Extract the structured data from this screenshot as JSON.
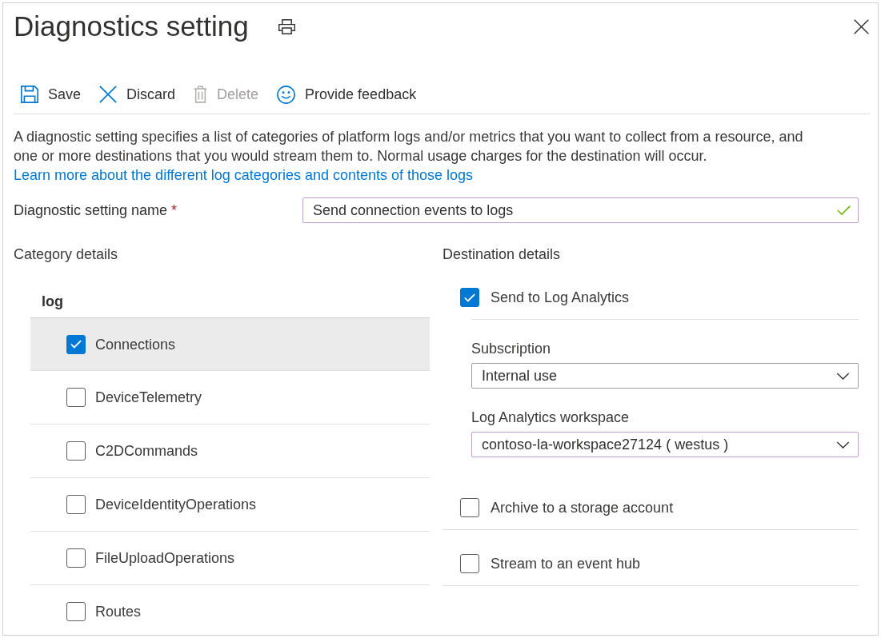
{
  "panel": {
    "title": "Diagnostics setting"
  },
  "toolbar": [
    {
      "kind": "save",
      "label": "Save",
      "disabled": false
    },
    {
      "kind": "discard",
      "label": "Discard",
      "disabled": false
    },
    {
      "kind": "delete",
      "label": "Delete",
      "disabled": true
    },
    {
      "kind": "feedback",
      "label": "Provide feedback",
      "disabled": false
    }
  ],
  "description": {
    "text": "A diagnostic setting specifies a list of categories of platform logs and/or metrics that you want to collect from a resource, and one or more destinations that you would stream them to. Normal usage charges for the destination will occur.",
    "link": "Learn more about the different log categories and contents of those logs"
  },
  "setting_name": {
    "label": "Diagnostic setting name",
    "required_mark": "*",
    "value": "Send connection events to logs",
    "valid": true
  },
  "category_details": {
    "heading": "Category details",
    "column_header": "log",
    "categories": [
      {
        "label": "Connections",
        "checked": true,
        "selected": true
      },
      {
        "label": "DeviceTelemetry",
        "checked": false,
        "selected": false
      },
      {
        "label": "C2DCommands",
        "checked": false,
        "selected": false
      },
      {
        "label": "DeviceIdentityOperations",
        "checked": false,
        "selected": false
      },
      {
        "label": "FileUploadOperations",
        "checked": false,
        "selected": false
      },
      {
        "label": "Routes",
        "checked": false,
        "selected": false
      }
    ]
  },
  "destination_details": {
    "heading": "Destination details",
    "destinations": [
      {
        "label": "Send to Log Analytics",
        "checked": true,
        "fields": [
          {
            "label": "Subscription",
            "value": "Internal use",
            "focused": false
          },
          {
            "label": "Log Analytics workspace",
            "value": "contoso-la-workspace27124 ( westus )",
            "focused": true
          }
        ]
      },
      {
        "label": "Archive to a storage account",
        "checked": false
      },
      {
        "label": "Stream to an event hub",
        "checked": false
      }
    ]
  }
}
